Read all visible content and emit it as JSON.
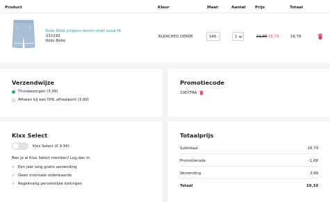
{
  "cart": {
    "headers": {
      "product": "Product",
      "kleur": "Kleur",
      "maat": "Maat",
      "aantal": "Aantal",
      "prijs": "Prijs",
      "totaal": "Totaal"
    },
    "item": {
      "name": "Koko Noko jongens denim short loose fit",
      "sku": "232192",
      "brand": "Koko Noko",
      "color": "BLEACHED DENIM",
      "size": "140",
      "quantity": "1",
      "old_price": "21,99",
      "new_price": "16,79",
      "total": "16,79"
    }
  },
  "shipping": {
    "title": "Verzendwijze",
    "options": [
      {
        "label": "Thuisbezorgen (3,99)",
        "selected": true
      },
      {
        "label": "Afhalen bij een DHL afhaalpunt (3,99)",
        "selected": false
      }
    ]
  },
  "promo": {
    "title": "Promotiecode",
    "code": "10EXTRA"
  },
  "kixx": {
    "title": "Kixx Select",
    "toggle_label": "Kixx Select (€ 9.99)",
    "member_text": "Ben je al Kixx Select member? Log dan in.",
    "benefits": [
      "Een jaar lang gratis verzending",
      "Geen minimale orderwaarde",
      "Regelmatig persoonlijke kortingen"
    ]
  },
  "totals": {
    "title": "Totaalprijs",
    "rows": [
      {
        "label": "Subtotaal",
        "value": "16,79"
      },
      {
        "label": "Promotiecode",
        "value": "- 1,68"
      },
      {
        "label": "Verzending",
        "value": "3,99"
      },
      {
        "label": "Totaal",
        "value": "19,10"
      }
    ]
  },
  "colors": {
    "accent_teal": "#1fa3a3",
    "sale_pink": "#e53d6b",
    "background": "#f4f4f4"
  },
  "icons": [
    "chevron-down-icon",
    "trash-icon",
    "check-icon"
  ]
}
